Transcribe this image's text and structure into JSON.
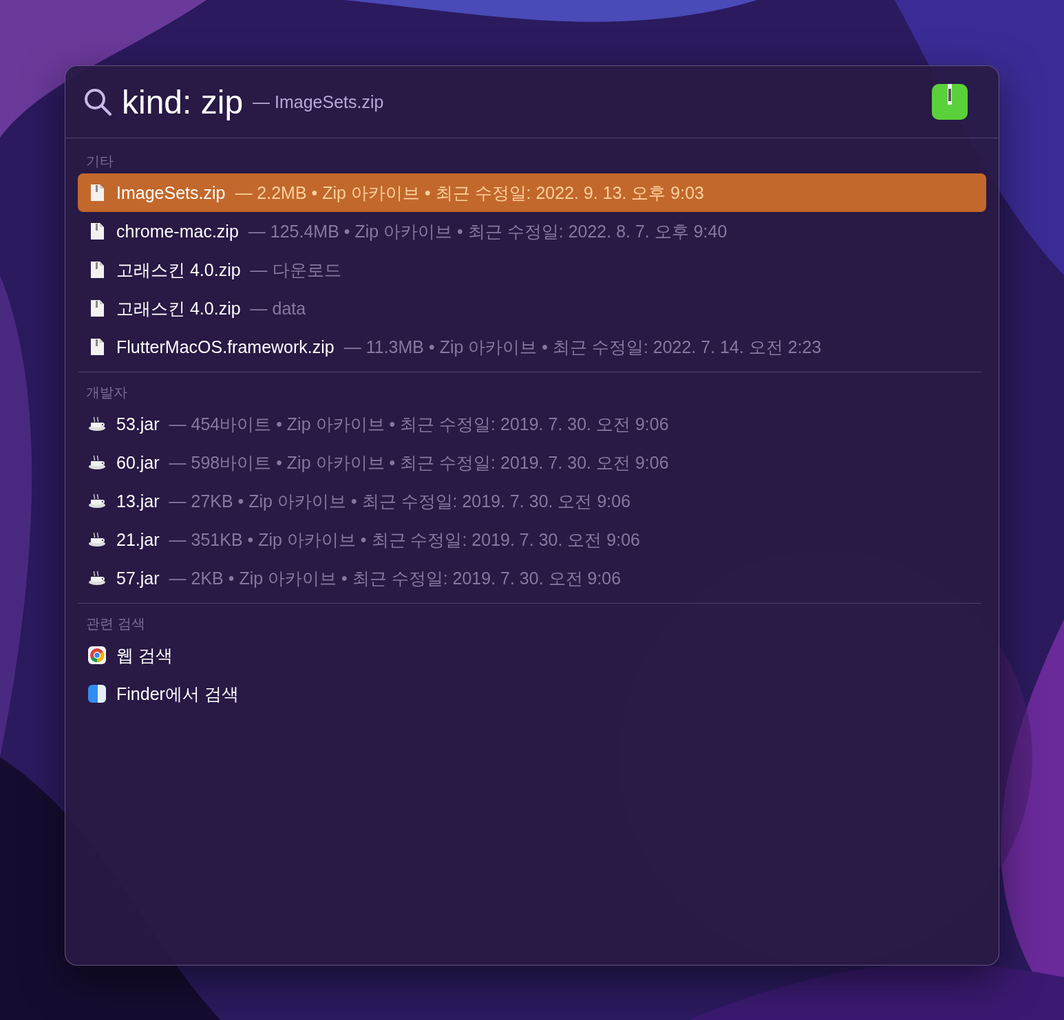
{
  "search": {
    "query": "kind: zip",
    "hint": "— ImageSets.zip"
  },
  "sections": [
    {
      "title": "기타",
      "items": [
        {
          "kind": "file",
          "name": "ImageSets.zip",
          "detail": "— 2.2MB • Zip 아카이브 • 최근 수정일: 2022. 9. 13. 오후 9:03",
          "selected": true
        },
        {
          "kind": "file",
          "name": "chrome-mac.zip",
          "detail": "— 125.4MB • Zip 아카이브 • 최근 수정일: 2022. 8. 7. 오후 9:40",
          "selected": false
        },
        {
          "kind": "file",
          "name": "고래스킨 4.0.zip",
          "detail": "— 다운로드",
          "selected": false
        },
        {
          "kind": "file",
          "name": "고래스킨 4.0.zip",
          "detail": "— data",
          "selected": false
        },
        {
          "kind": "file",
          "name": "FlutterMacOS.framework.zip",
          "detail": "— 11.3MB • Zip 아카이브 • 최근 수정일: 2022. 7. 14. 오전 2:23",
          "selected": false
        }
      ]
    },
    {
      "title": "개발자",
      "items": [
        {
          "kind": "jar",
          "name": "53.jar",
          "detail": "— 454바이트 • Zip 아카이브 • 최근 수정일: 2019. 7. 30. 오전 9:06",
          "selected": false
        },
        {
          "kind": "jar",
          "name": "60.jar",
          "detail": "— 598바이트 • Zip 아카이브 • 최근 수정일: 2019. 7. 30. 오전 9:06",
          "selected": false
        },
        {
          "kind": "jar",
          "name": "13.jar",
          "detail": "— 27KB • Zip 아카이브 • 최근 수정일: 2019. 7. 30. 오전 9:06",
          "selected": false
        },
        {
          "kind": "jar",
          "name": "21.jar",
          "detail": "— 351KB • Zip 아카이브 • 최근 수정일: 2019. 7. 30. 오전 9:06",
          "selected": false
        },
        {
          "kind": "jar",
          "name": "57.jar",
          "detail": "— 2KB • Zip 아카이브 • 최근 수정일: 2019. 7. 30. 오전 9:06",
          "selected": false
        }
      ]
    },
    {
      "title": "관련 검색",
      "items": [
        {
          "kind": "web",
          "name": "웹 검색",
          "selected": false
        },
        {
          "kind": "finder",
          "name": "Finder에서 검색",
          "selected": false
        }
      ]
    }
  ]
}
